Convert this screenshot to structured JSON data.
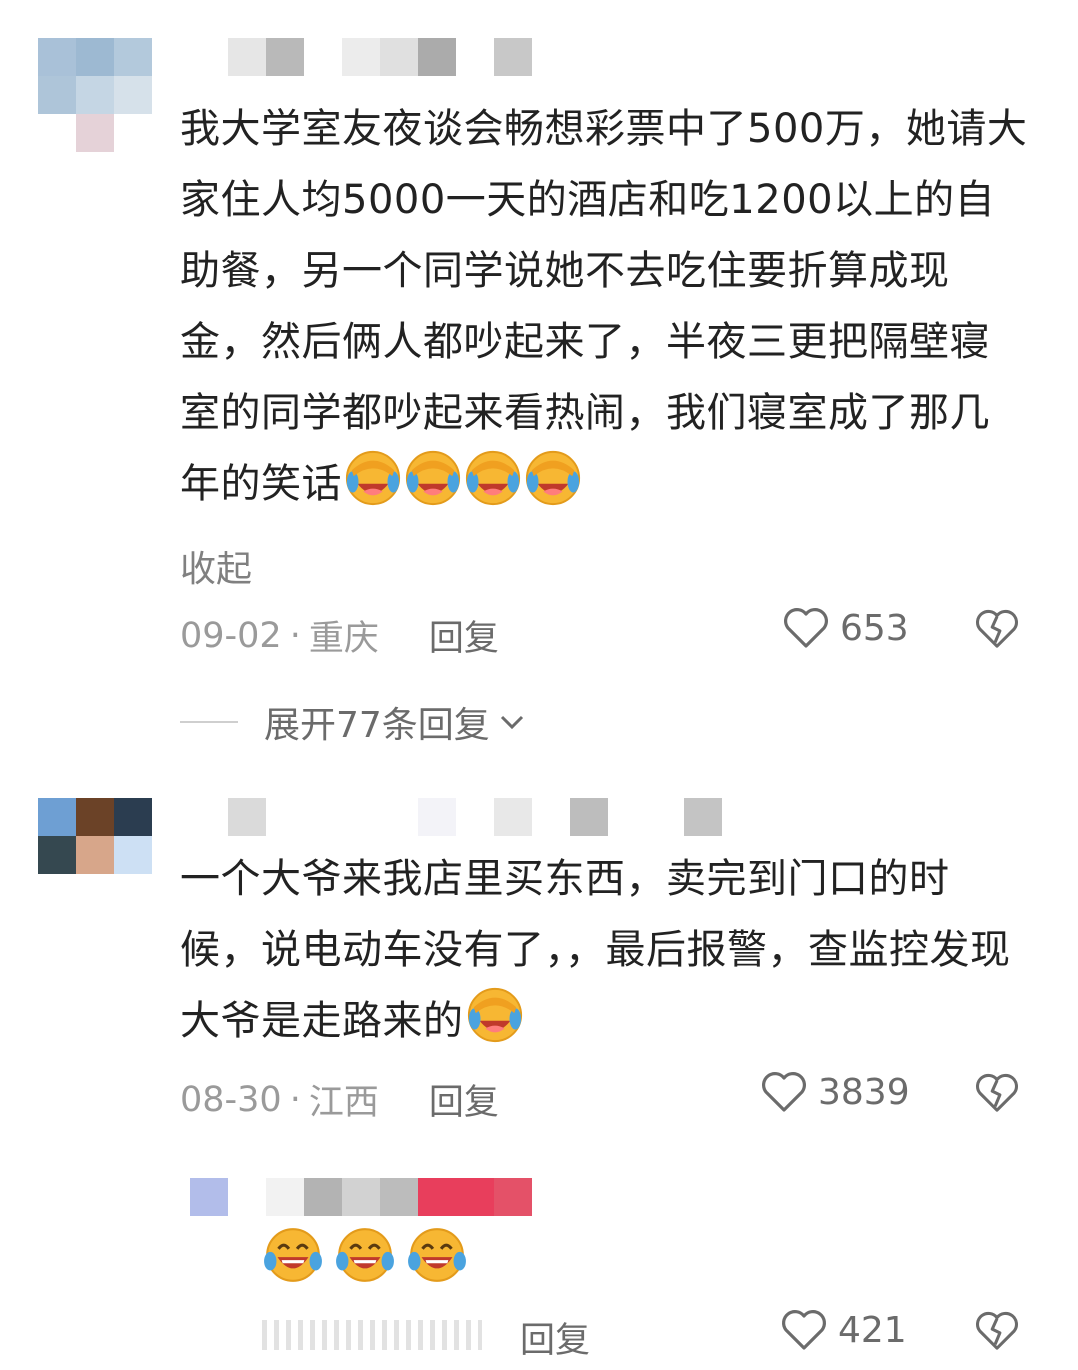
{
  "colors": {
    "text": "#222222",
    "meta": "#9a9a9a",
    "action": "#6b6b6b",
    "emoji_face": "#f7b733"
  },
  "comments": [
    {
      "text": "我大学室友夜谈会畅想彩票中了500万，她请大家住人均5000一天的酒店和吃1200以上的自助餐，另一个同学说她不去吃住要折算成现金，然后俩人都吵起来了，半夜三更把隔壁寝室的同学都吵起来看热闹，我们寝室成了那几年的笑话",
      "emoji_icons": [
        "facepalm-laugh-icon",
        "facepalm-laugh-icon",
        "facepalm-laugh-icon",
        "facepalm-laugh-icon"
      ],
      "collapse_label": "收起",
      "date": "09-02",
      "separator": "·",
      "location": "重庆",
      "reply_label": "回复",
      "likes": "653",
      "expand_label": "展开77条回复"
    },
    {
      "text": "一个大爷来我店里买东西，卖完到门口的时候，说电动车没有了，，最后报警，查监控发现大爷是走路来的",
      "emoji_icons": [
        "facepalm-laugh-icon"
      ],
      "date": "08-30",
      "separator": "·",
      "location": "江西",
      "reply_label": "回复",
      "likes": "3839"
    },
    {
      "emoji_icons": [
        "tears-of-joy-icon",
        "tears-of-joy-icon",
        "tears-of-joy-icon"
      ],
      "reply_label": "回复",
      "likes": "421"
    }
  ]
}
